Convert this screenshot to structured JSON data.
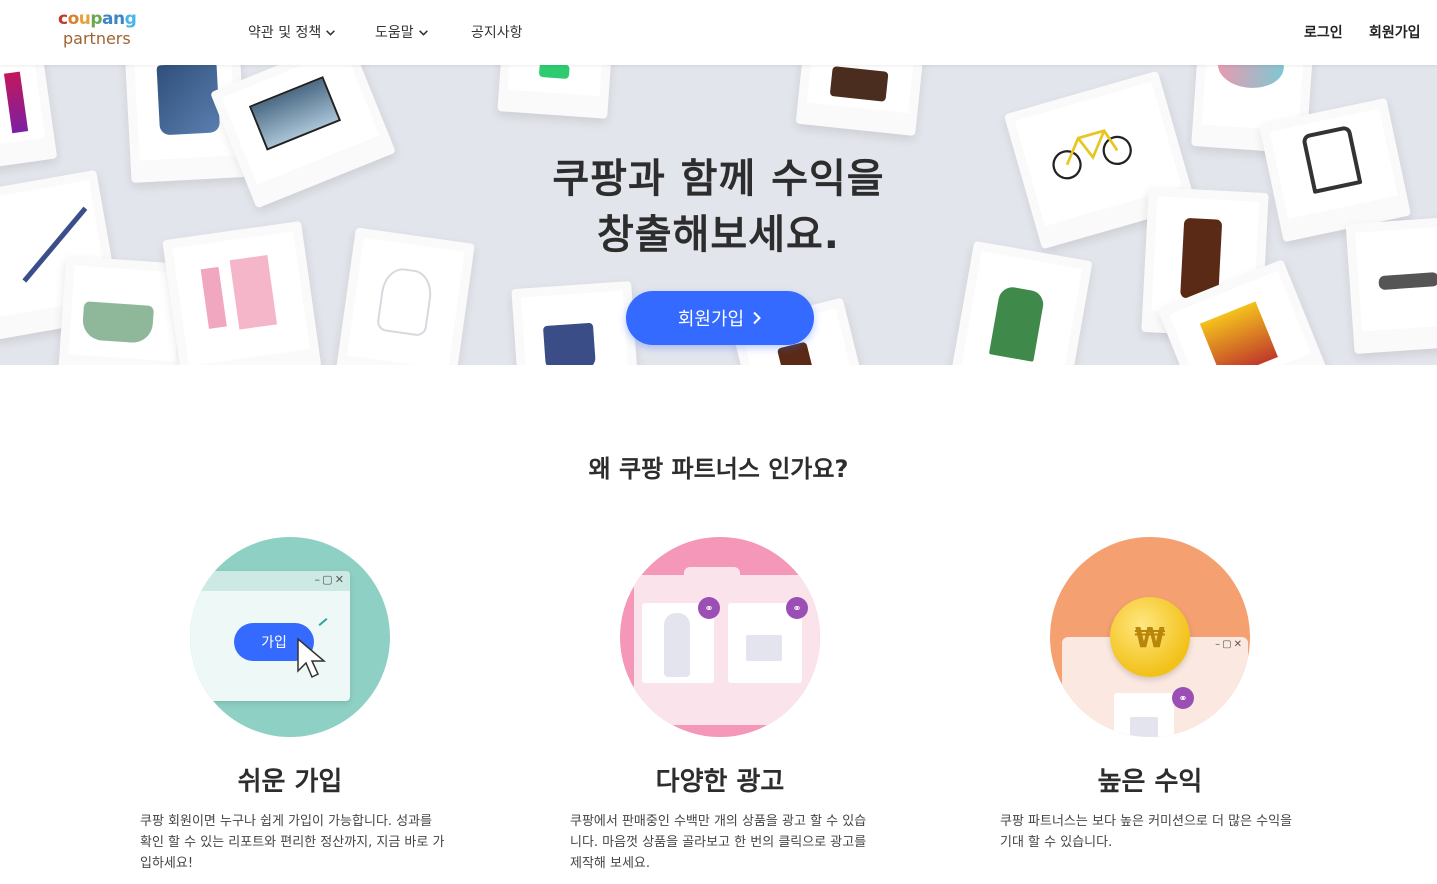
{
  "header": {
    "logo_line1": "coupang",
    "logo_line2": "partners",
    "nav": [
      {
        "label": "약관 및 정책",
        "has_dropdown": true
      },
      {
        "label": "도움말",
        "has_dropdown": true
      },
      {
        "label": "공지사항",
        "has_dropdown": false
      }
    ],
    "login": "로그인",
    "signup": "회원가입"
  },
  "hero": {
    "title_line1": "쿠팡과 함께 수익을",
    "title_line2": "창출해보세요.",
    "cta": "회원가입",
    "background": "#e3e5ec",
    "cta_color": "#346aff"
  },
  "why": {
    "title": "왜 쿠팡 파트너스 인가요?",
    "features": [
      {
        "title": "쉬운 가입",
        "desc": "쿠팡 회원이면 누구나 쉽게 가입이 가능합니다. 성과를 확인 할 수 있는 리포트와 편리한 정산까지, 지금 바로 가입하세요!",
        "illustration_button": "가입",
        "circle_color": "#8fd0c4"
      },
      {
        "title": "다양한 광고",
        "desc": "쿠팡에서 판매중인 수백만 개의 상품을 광고 할 수 있습니다. 마음껏 상품을 골라보고 한 번의 클릭으로 광고를 제작해 보세요.",
        "circle_color": "#f497b8"
      },
      {
        "title": "높은 수익",
        "desc": "쿠팡 파트너스는 보다 높은 커미션으로 더 많은 수익을 기대 할 수 있습니다.",
        "coin_symbol": "₩",
        "circle_color": "#f4a070"
      }
    ]
  },
  "icons": [
    "chevron-down-icon",
    "chevron-right-icon",
    "link-icon",
    "cursor-icon",
    "window-controls-icon"
  ]
}
